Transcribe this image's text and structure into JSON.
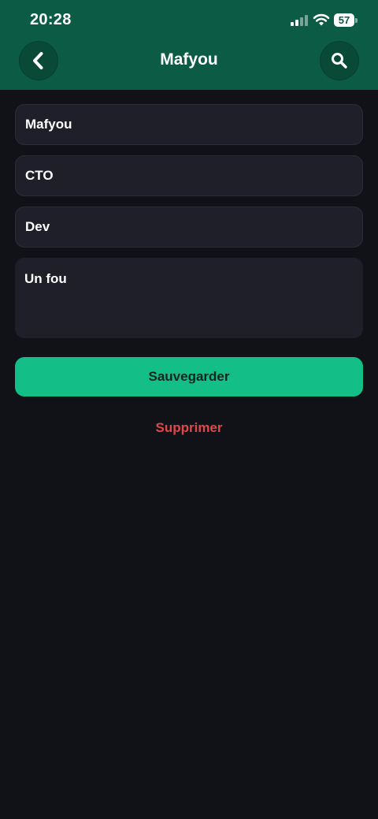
{
  "status_bar": {
    "time": "20:28",
    "battery_level": "57"
  },
  "header": {
    "title": "Mafyou",
    "back_icon": "chevron-left-icon",
    "search_icon": "search-icon"
  },
  "form": {
    "name_value": "Mafyou",
    "role_value": "CTO",
    "team_value": "Dev",
    "notes_value": "Un fou"
  },
  "actions": {
    "save_label": "Sauvegarder",
    "delete_label": "Supprimer"
  },
  "colors": {
    "header_bg": "#0c5c45",
    "background": "#111217",
    "field_bg": "#1e1f29",
    "accent": "#13bf87",
    "danger": "#e04848"
  }
}
